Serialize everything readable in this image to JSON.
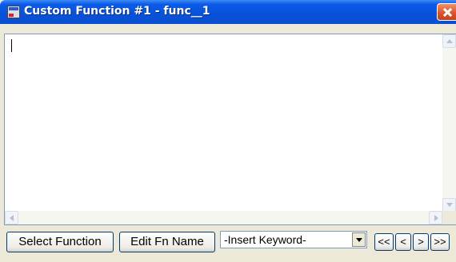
{
  "window": {
    "title": "Custom Function #1 - func__1"
  },
  "icons": {
    "app": "app-icon",
    "close": "close-icon"
  },
  "editor": {
    "value": ""
  },
  "toolbar": {
    "select_function_label": "Select Function",
    "edit_fn_name_label": "Edit Fn Name",
    "keyword_select_value": "-Insert Keyword-",
    "nav_first_label": "<<",
    "nav_prev_label": "<",
    "nav_next_label": ">",
    "nav_last_label": ">>"
  },
  "colors": {
    "titlebar": "#0a55e6",
    "close": "#d9532a",
    "face": "#ece9d8"
  }
}
